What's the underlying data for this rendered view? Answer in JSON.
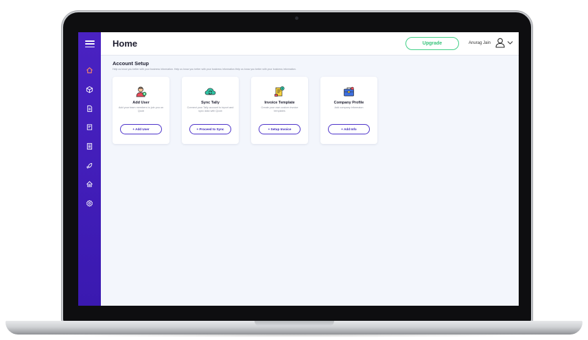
{
  "header": {
    "title": "Home",
    "upgrade_label": "Upgrade",
    "user_name": "Anurag Jain"
  },
  "sidebar": {
    "items": [
      {
        "icon": "home-icon",
        "active": true
      },
      {
        "icon": "box-icon"
      },
      {
        "icon": "document-icon"
      },
      {
        "icon": "edit-document-icon"
      },
      {
        "icon": "list-document-icon"
      },
      {
        "icon": "rocket-icon"
      },
      {
        "icon": "house-settings-icon"
      },
      {
        "icon": "gear-icon"
      }
    ]
  },
  "account_setup": {
    "title": "Account Setup",
    "subtitle": "Help us know you better with your business information. Help us know you better with your business information.Help us know you better with your business information.",
    "cards": [
      {
        "title": "Add User",
        "description": "Add your team members to join you on Qoob",
        "button": "+ Add User",
        "icon": "user-add-icon"
      },
      {
        "title": "Sync Tally",
        "description": "Connect your Tally account to inport and sync data with Qoob",
        "button": "+ Proceed to Sync",
        "icon": "cloud-sync-icon"
      },
      {
        "title": "Invoice Template",
        "description": "Create your own custom invoice templates",
        "button": "+ Setup Invoice",
        "icon": "invoice-icon"
      },
      {
        "title": "Company Profile",
        "description": "Add company informaion",
        "button": "+ Add Info",
        "icon": "briefcase-icon"
      }
    ]
  },
  "colors": {
    "sidebar": "#3a19b0",
    "accent": "#4a30c9",
    "upgrade": "#3fcf86",
    "background": "#f3f6fc"
  }
}
